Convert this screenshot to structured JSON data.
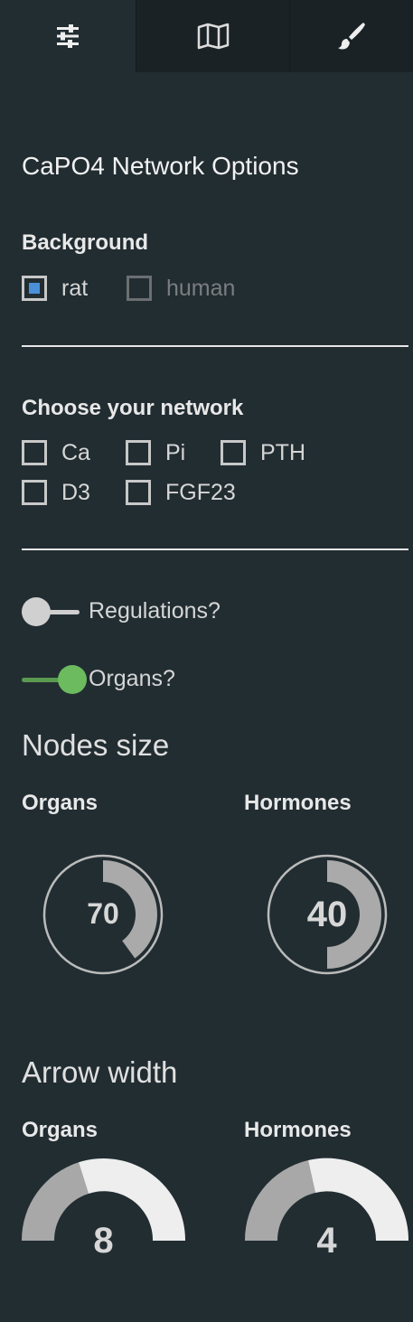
{
  "tabs": [
    {
      "icon": "sliders-icon",
      "active": true
    },
    {
      "icon": "map-icon",
      "active": false
    },
    {
      "icon": "paintbrush-icon",
      "active": false
    }
  ],
  "panel": {
    "title": "CaPO4 Network Options",
    "background": {
      "label": "Background",
      "options": [
        {
          "label": "rat",
          "checked": true,
          "enabled": true
        },
        {
          "label": "human",
          "checked": false,
          "enabled": false
        }
      ]
    },
    "network": {
      "label": "Choose your network",
      "options": [
        {
          "label": "Ca",
          "checked": false
        },
        {
          "label": "Pi",
          "checked": false
        },
        {
          "label": "PTH",
          "checked": false
        },
        {
          "label": "D3",
          "checked": false
        },
        {
          "label": "FGF23",
          "checked": false
        }
      ]
    },
    "toggles": [
      {
        "label": "Regulations?",
        "on": false
      },
      {
        "label": "Organs?",
        "on": true
      }
    ],
    "nodes_size": {
      "title": "Nodes size",
      "organs": {
        "label": "Organs",
        "value": "70",
        "fraction": 0.7
      },
      "hormones": {
        "label": "Hormones",
        "value": "40",
        "fraction": 0.5
      }
    },
    "arrow_width": {
      "title": "Arrow width",
      "organs": {
        "label": "Organs",
        "value": "8"
      },
      "hormones": {
        "label": "Hormones",
        "value": "4"
      }
    }
  },
  "colors": {
    "background": "#222d32",
    "checkbox_fill": "#4a90d9",
    "toggle_on": "#6cbb5f",
    "knob_fill": "#aaaaaa",
    "gauge_light": "#eeeeee"
  }
}
